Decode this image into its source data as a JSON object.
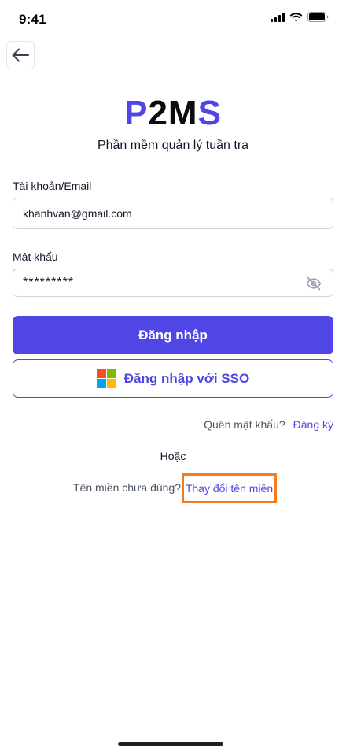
{
  "status_bar": {
    "time": "9:41"
  },
  "header": {
    "back_icon": "arrow-left-icon"
  },
  "logo": {
    "part1": "P",
    "part2": "2M",
    "part3": "S"
  },
  "subtitle": "Phần mềm quản lý tuần tra",
  "login_form": {
    "account_label": "Tài khoản/Email",
    "account_value": "khanhvan@gmail.com",
    "password_label": "Mật khẩu",
    "password_value": "*********",
    "password_toggle_icon": "eye-off-icon",
    "login_button": "Đăng nhập",
    "sso_button": "Đăng nhập với SSO"
  },
  "links": {
    "forgot_password": "Quên mật khẩu?",
    "register": "Đăng ký"
  },
  "or_text": "Hoặc",
  "domain": {
    "prompt": "Tên miền chưa đúng?",
    "change_link": "Thay đổi tên miền"
  },
  "colors": {
    "primary": "#4f46e5",
    "highlight": "#f47b20",
    "ms_red": "#f25022",
    "ms_green": "#7fba00",
    "ms_blue": "#00a4ef",
    "ms_yellow": "#ffb900"
  }
}
